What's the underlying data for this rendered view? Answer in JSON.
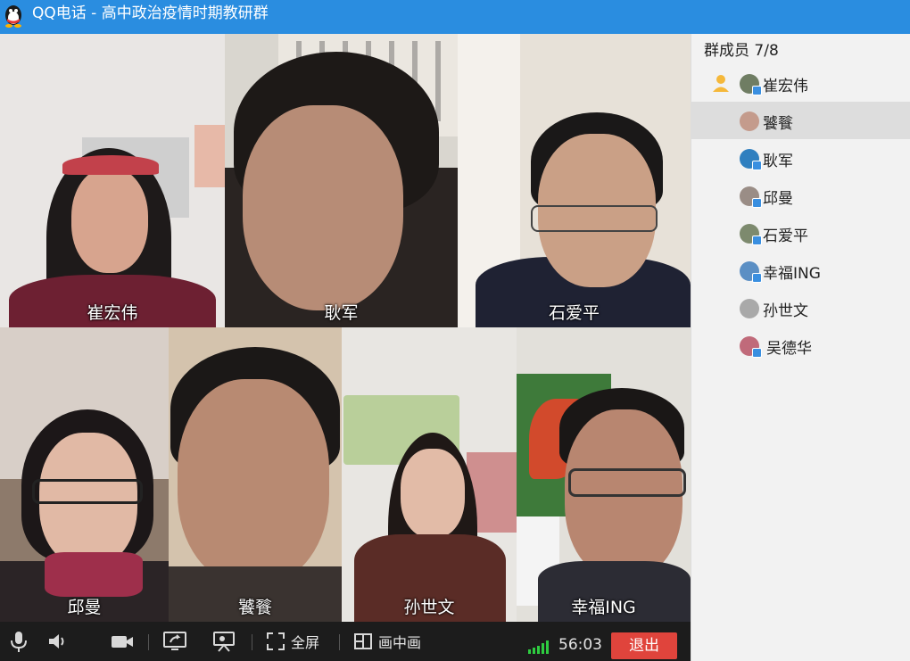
{
  "window": {
    "app": "QQ电话",
    "separator": " - ",
    "group": "高中政治疫情时期教研群"
  },
  "colors": {
    "titlebar": "#2a8de0",
    "exit": "#e0443c",
    "signal": "#2ecc40",
    "toolbar": "#1c1c1c"
  },
  "tiles": [
    {
      "name": "崔宏伟"
    },
    {
      "name": "耿军"
    },
    {
      "name": "石爱平"
    },
    {
      "name": "邱曼"
    },
    {
      "name": "饕餮"
    },
    {
      "name": "孙世文"
    },
    {
      "name": "幸福ING"
    }
  ],
  "toolbar": {
    "icons": [
      "microphone-icon",
      "speaker-icon",
      "camera-icon",
      "share-screen-icon",
      "slideshow-icon"
    ],
    "fullscreen_label": "全屏",
    "pip_label": "画中画",
    "timer": "56:03",
    "exit_label": "退出"
  },
  "sidebar": {
    "header": "群成员 7/8",
    "members": [
      {
        "name": "崔宏伟",
        "host": true
      },
      {
        "name": "饕餮",
        "selected": true
      },
      {
        "name": "耿军"
      },
      {
        "name": "邱曼"
      },
      {
        "name": "石爱平"
      },
      {
        "name": "幸福ING"
      },
      {
        "name": "孙世文"
      },
      {
        "name": "吴德华"
      }
    ]
  }
}
